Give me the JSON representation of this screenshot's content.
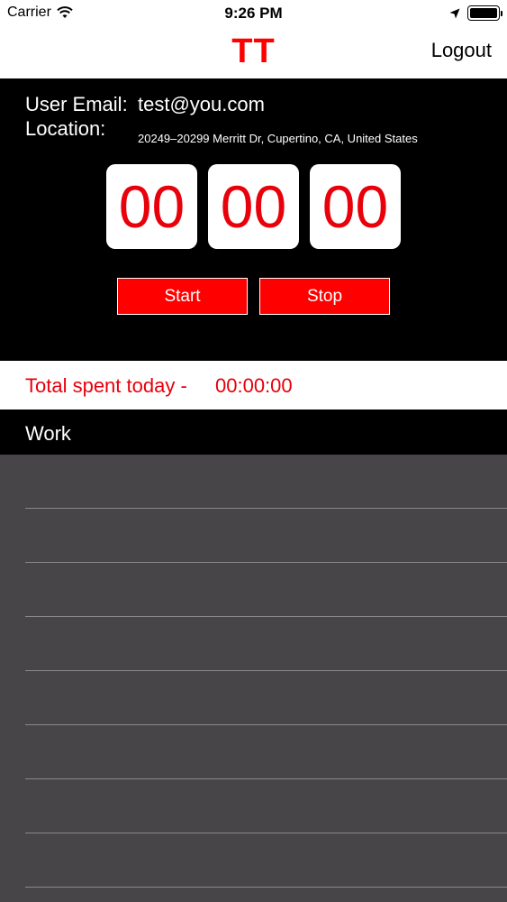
{
  "status_bar": {
    "carrier": "Carrier",
    "time": "9:26 PM",
    "icons": [
      "wifi-icon",
      "location-arrow-icon",
      "battery-icon"
    ]
  },
  "nav": {
    "title": "TT",
    "logout_label": "Logout"
  },
  "info": {
    "email_label": "User Email:",
    "email_value": "test@you.com",
    "location_label": "Location:",
    "location_value": "20249–20299 Merritt Dr, Cupertino, CA, United States"
  },
  "timer": {
    "hours": "00",
    "minutes": "00",
    "seconds": "00"
  },
  "controls": {
    "start_label": "Start",
    "stop_label": "Stop"
  },
  "total": {
    "label": "Total spent today -",
    "value": "00:00:00"
  },
  "section": {
    "title": "Work"
  },
  "list": {
    "rows": [
      "",
      "",
      "",
      "",
      "",
      "",
      "",
      ""
    ]
  },
  "colors": {
    "accent": "#ff0000",
    "timer_text": "#e8000b",
    "panel_bg": "#000000",
    "list_bg": "#474548",
    "separator": "#8a888b"
  }
}
